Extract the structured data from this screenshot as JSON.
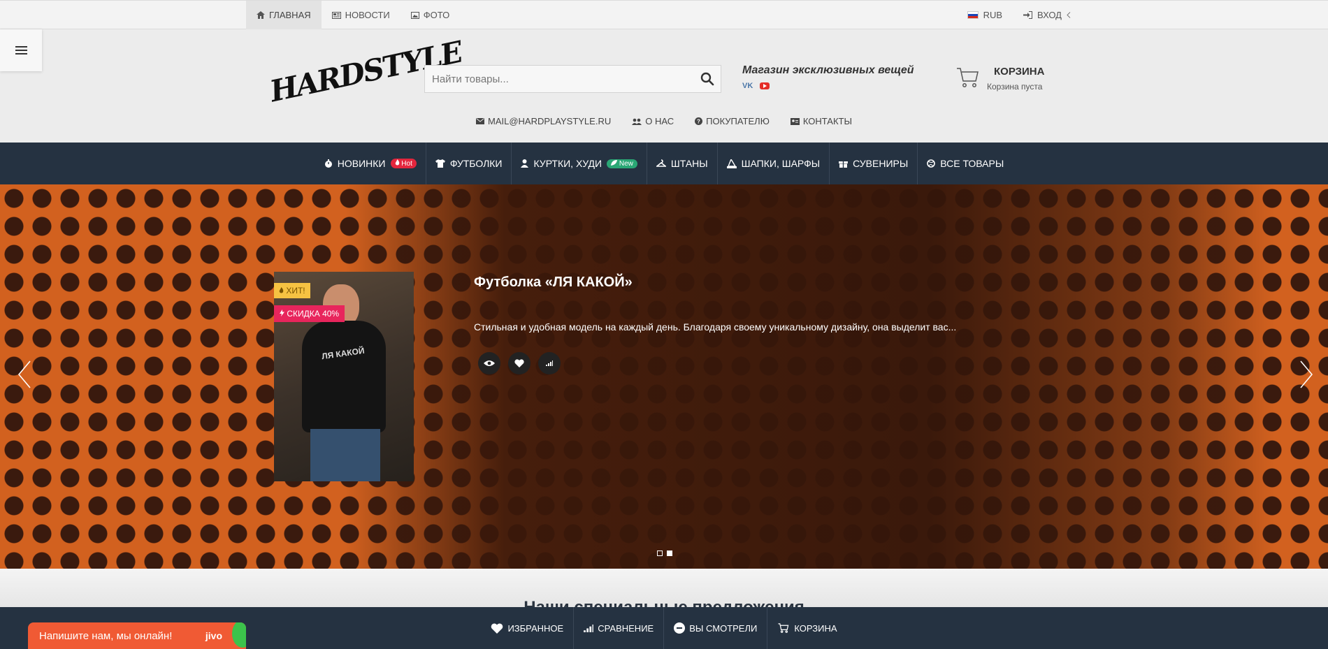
{
  "topbar": {
    "nav": [
      {
        "label": "Главная",
        "icon": "home-icon"
      },
      {
        "label": "Новости",
        "icon": "news-icon"
      },
      {
        "label": "Фото",
        "icon": "photo-icon"
      }
    ],
    "currency": "RUB",
    "login": "Вход"
  },
  "header": {
    "logo": "HARDSTYLE",
    "search_placeholder": "Найти товары...",
    "tagline": "Магазин эксклюзивных вещей",
    "social": {
      "vk": "VK",
      "youtube": "YouTube"
    },
    "cart_title": "Корзина",
    "cart_status": "Корзина пуста",
    "subnav": [
      {
        "label": "mail@hardplaystyle.ru",
        "icon": "mail-icon"
      },
      {
        "label": "О нас",
        "icon": "users-icon"
      },
      {
        "label": "Покупателю",
        "icon": "question-icon"
      },
      {
        "label": "Контакты",
        "icon": "contact-card-icon"
      }
    ]
  },
  "mainnav": [
    {
      "label": "Новинки",
      "badge": "Hot"
    },
    {
      "label": "Футболки",
      "badge": ""
    },
    {
      "label": "Куртки, худи",
      "badge": "New"
    },
    {
      "label": "Штаны",
      "badge": ""
    },
    {
      "label": "Шапки, шарфы",
      "badge": ""
    },
    {
      "label": "Сувениры",
      "badge": ""
    },
    {
      "label": "Все товары",
      "badge": ""
    }
  ],
  "hero": {
    "label_hit": "ХИТ!",
    "label_sale": "СКИДКА 40%",
    "image_print": "ЛЯ КАКОЙ",
    "title": "Футболка «ЛЯ КАКОЙ»",
    "description": "Стильная и удобная модель на каждый день. Благодаря своему уникальному дизайну, она выделит вас...",
    "slides": 2,
    "active_slide": 2
  },
  "section_title": "Наши специальные предложения",
  "bottombar": [
    {
      "label": "Избранное",
      "icon": "heart-icon"
    },
    {
      "label": "Сравнение",
      "icon": "compare-bars-icon"
    },
    {
      "label": "Вы смотрели",
      "icon": "eye-icon"
    },
    {
      "label": "Корзина",
      "icon": "cart-icon"
    }
  ],
  "chat": {
    "text": "Напишите нам, мы онлайн!",
    "brand": "jivo"
  },
  "colors": {
    "navy": "#253241",
    "orange": "#d2611f",
    "hot": "#e3263d",
    "new": "#2aa775",
    "sale": "#e8255c",
    "hit": "#f6c242",
    "chat": "#f05a34"
  }
}
